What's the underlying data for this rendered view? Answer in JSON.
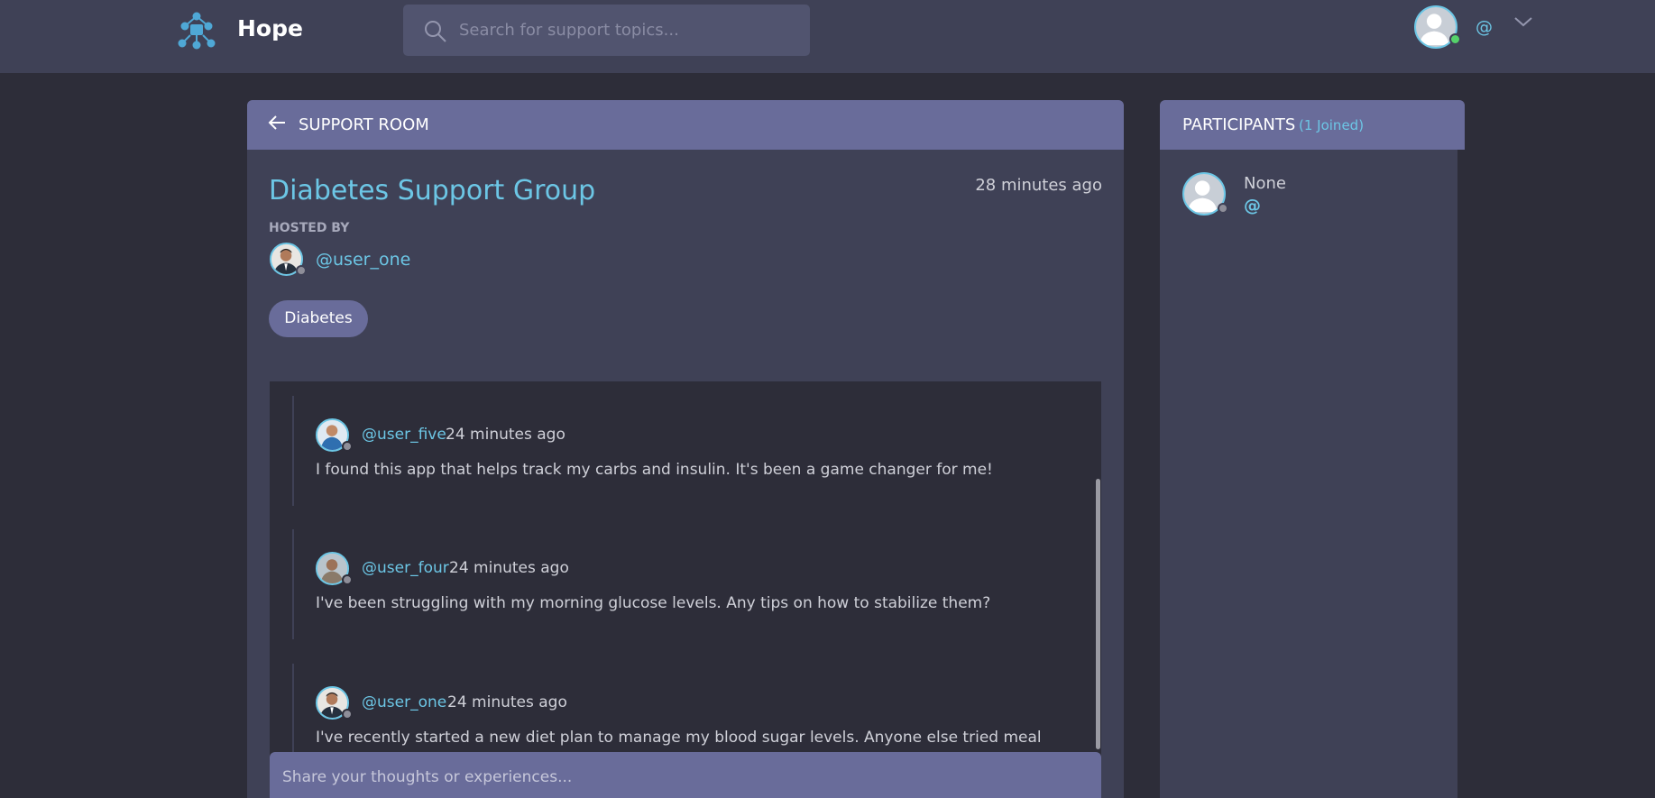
{
  "app": {
    "brand": "Hope",
    "colors": {
      "accent": "#6cc6e5",
      "header_bar": "#3f4156",
      "panel_header": "#696c9a",
      "online": "#55d26a"
    }
  },
  "search": {
    "placeholder": "Search for support topics...",
    "value": ""
  },
  "current_user": {
    "handle": "@",
    "avatar_icon": "default-user-avatar",
    "status": "online"
  },
  "room": {
    "header_label": "SUPPORT ROOM",
    "title": "Diabetes Support Group",
    "created": "28 minutes ago",
    "hosted_by_label": "HOSTED BY",
    "host": "@user_one",
    "topic": "Diabetes"
  },
  "messages": [
    {
      "user": "@user_five",
      "time": "24 minutes ago",
      "body": "I found this app that helps track my carbs and insulin. It's been a game changer for me!"
    },
    {
      "user": "@user_four",
      "time": "24 minutes ago",
      "body": "I've been struggling with my morning glucose levels. Any tips on how to stabilize them?"
    },
    {
      "user": "@user_one",
      "time": "24 minutes ago",
      "body": "I've recently started a new diet plan to manage my blood sugar levels. Anyone else tried meal"
    }
  ],
  "composer": {
    "placeholder": "Share your thoughts or experiences...",
    "value": ""
  },
  "participants": {
    "title": "PARTICIPANTS",
    "count_label": "(1 Joined)",
    "list": [
      {
        "name": "None",
        "handle": "@"
      }
    ]
  }
}
